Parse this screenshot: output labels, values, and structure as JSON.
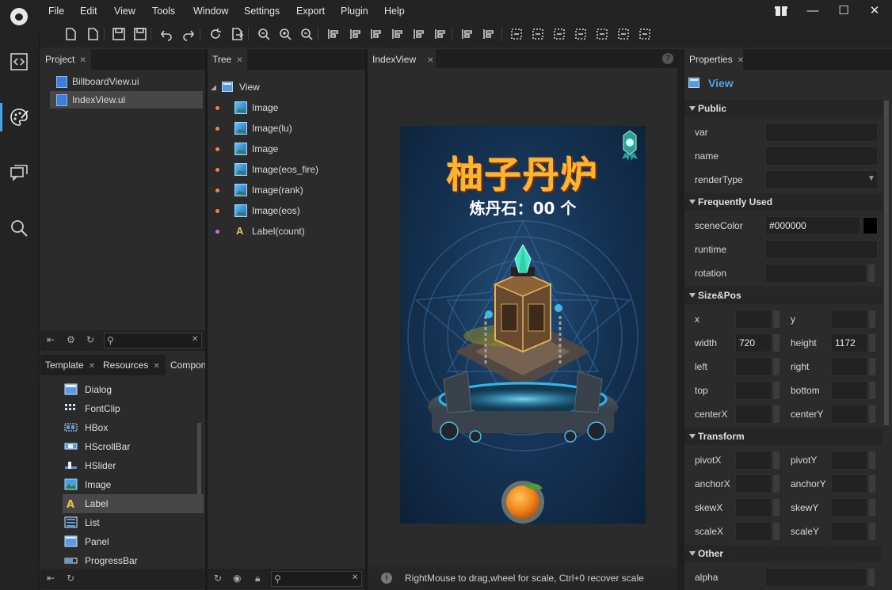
{
  "menu": [
    "File",
    "Edit",
    "View",
    "Tools",
    "Window",
    "Settings",
    "Export",
    "Plugin",
    "Help"
  ],
  "icons": {
    "toolbar": [
      "new-file-icon",
      "new-page-icon",
      "save-icon",
      "save-all-icon",
      "undo-icon",
      "redo-icon",
      "refresh-icon",
      "export-icon",
      "zoom-out-icon",
      "zoom-in-icon",
      "zoom-reset-icon",
      "align-left-icon",
      "align-center-icon",
      "align-right-icon",
      "align-top-icon",
      "align-middle-icon",
      "align-bottom-icon",
      "distribute-h-icon",
      "distribute-v-icon",
      "size-icon-1",
      "size-icon-2",
      "size-icon-3",
      "size-icon-4",
      "size-icon-5",
      "size-icon-6",
      "size-icon-7"
    ],
    "activity": [
      "code-icon",
      "palette-icon",
      "chat-icon",
      "search-icon"
    ]
  },
  "project": {
    "tab": "Project",
    "files": [
      "BillboardView.ui",
      "IndexView.ui"
    ],
    "selected_index": 1
  },
  "tree": {
    "tab": "Tree",
    "root": "View",
    "items": [
      {
        "label": "Image",
        "type": "image",
        "dot": "#e8864a"
      },
      {
        "label": "Image(lu)",
        "type": "image",
        "dot": "#e8864a"
      },
      {
        "label": "Image",
        "type": "image",
        "dot": "#e8864a"
      },
      {
        "label": "Image(eos_fire)",
        "type": "image",
        "dot": "#e8864a"
      },
      {
        "label": "Image(rank)",
        "type": "image",
        "dot": "#e8864a"
      },
      {
        "label": "Image(eos)",
        "type": "image",
        "dot": "#e8864a"
      },
      {
        "label": "Label(count)",
        "type": "label",
        "dot": "#d36bd3"
      }
    ]
  },
  "bottomTabs": [
    "Template",
    "Resources",
    "Compon"
  ],
  "components": [
    "Dialog",
    "FontClip",
    "HBox",
    "HScrollBar",
    "HSlider",
    "Image",
    "Label",
    "List",
    "Panel",
    "ProgressBar"
  ],
  "selectedComponent": "Label",
  "editor": {
    "tab": "IndexView",
    "status": "RightMouse to drag,wheel for scale, Ctrl+0 recover scale",
    "help": "?"
  },
  "game": {
    "title": "柚子丹炉",
    "counter": "炼丹石：00 个"
  },
  "properties": {
    "tab": "Properties",
    "node": "View",
    "sections": {
      "public": "Public",
      "frequent": "Frequently Used",
      "size": "Size&Pos",
      "transform": "Transform",
      "other": "Other"
    },
    "labels": {
      "var": "var",
      "name": "name",
      "renderType": "renderType",
      "sceneColor": "sceneColor",
      "runtime": "runtime",
      "rotation": "rotation",
      "x": "x",
      "y": "y",
      "width": "width",
      "height": "height",
      "left": "left",
      "right": "right",
      "top": "top",
      "bottom": "bottom",
      "centerX": "centerX",
      "centerY": "centerY",
      "pivotX": "pivotX",
      "pivotY": "pivotY",
      "anchorX": "anchorX",
      "anchorY": "anchorY",
      "skewX": "skewX",
      "skewY": "skewY",
      "scaleX": "scaleX",
      "scaleY": "scaleY",
      "alpha": "alpha"
    },
    "values": {
      "sceneColor": "#000000",
      "width": "720",
      "height": "1172"
    }
  },
  "colors": {
    "accent": "#4aa3e6",
    "bg": "#2b2b2b",
    "chrome": "#232323"
  }
}
